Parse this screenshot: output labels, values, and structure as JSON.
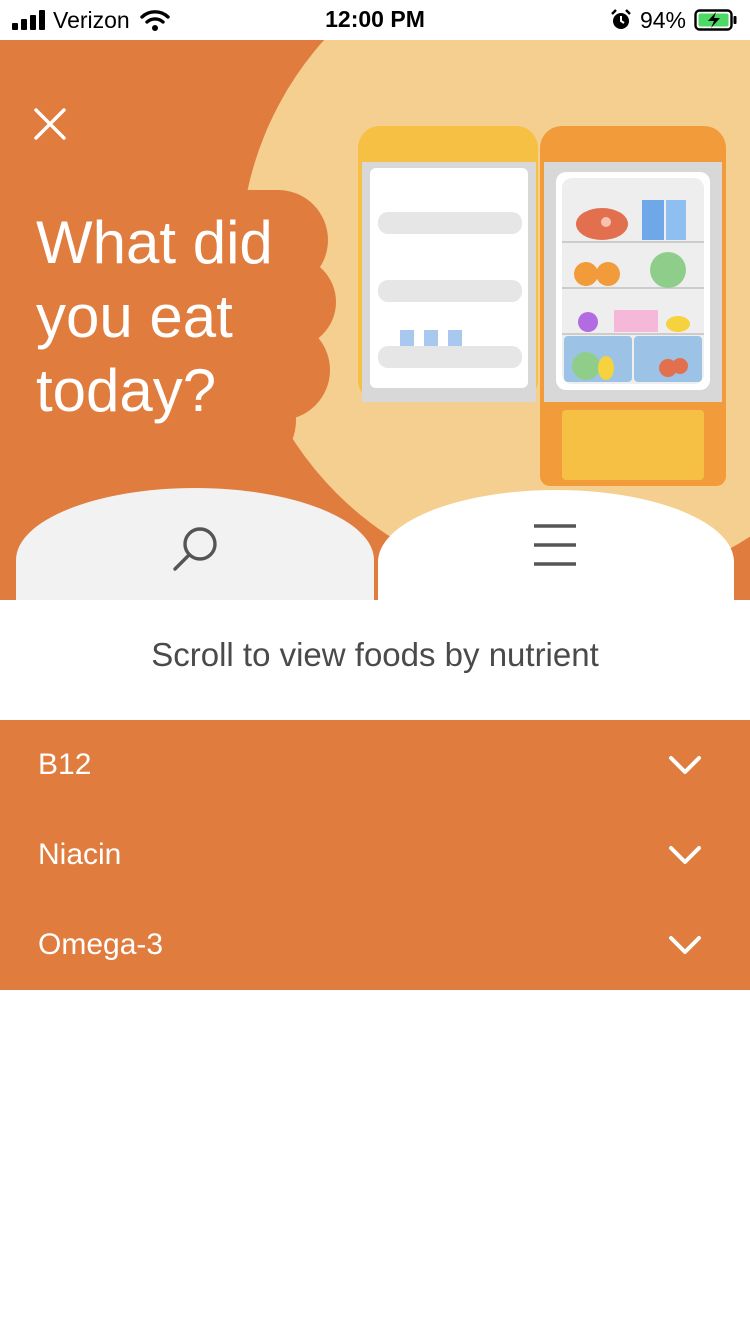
{
  "status_bar": {
    "carrier": "Verizon",
    "time": "12:00 PM",
    "battery": "94%"
  },
  "hero": {
    "title": "What did you eat today?"
  },
  "subtitle": "Scroll to view foods by nutrient",
  "nutrients": [
    {
      "label": "B12"
    },
    {
      "label": "Niacin"
    },
    {
      "label": "Omega-3"
    }
  ],
  "colors": {
    "accent": "#e07c3e",
    "hero_circle": "#f5cf8f",
    "fridge_door": "#f5c044",
    "fridge_body": "#f29b3a"
  }
}
